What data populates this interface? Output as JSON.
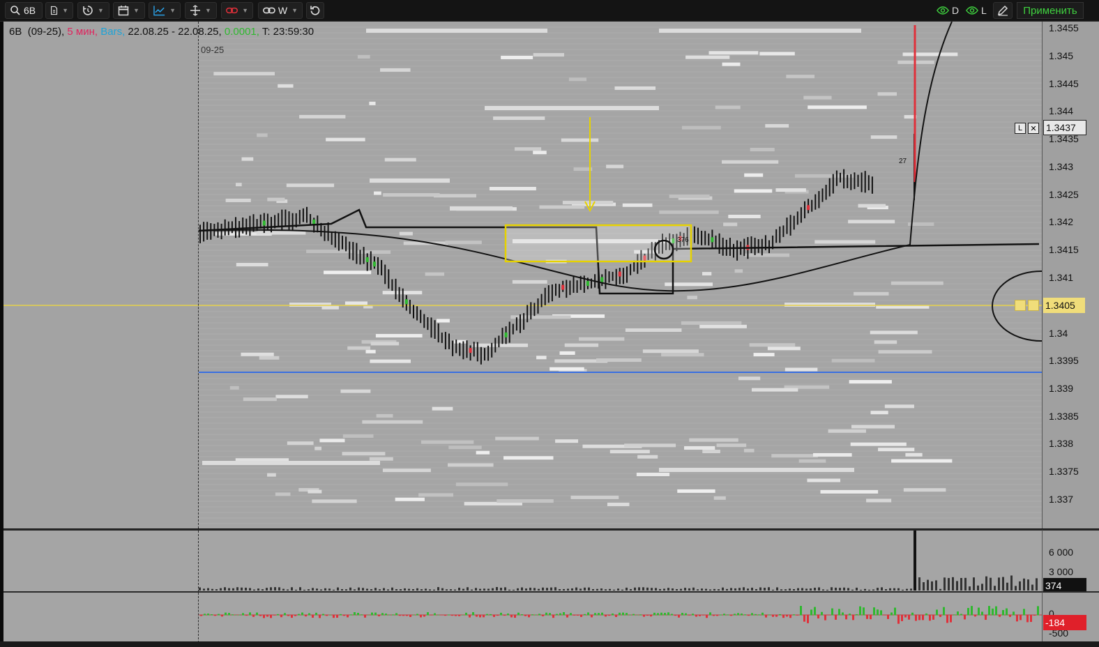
{
  "toolbar": {
    "symbol": "6B",
    "link_label": "W",
    "filter_d": "D",
    "filter_l": "L",
    "apply_label": "Применить"
  },
  "chart": {
    "symbol": "6B",
    "contract": "(09-25),",
    "timeframe": "5 мин,",
    "style": "Bars,",
    "dates": "22.08.25 - 22.08.25,",
    "tick": "0.0001,",
    "time": "T: 23:59:30",
    "contract_label": "09-25",
    "annotations": {
      "marker_a": "376",
      "marker_b": "27"
    },
    "colors": {
      "timeframe": "#e0245e",
      "style": "#1fa3d6",
      "tick": "#2fb82f",
      "yellow_line": "#e6d24a",
      "blue_line": "#3a6fe0"
    }
  },
  "price_axis": {
    "ticks": [
      "1.3455",
      "1.345",
      "1.3445",
      "1.344",
      "1.3435",
      "1.343",
      "1.3425",
      "1.342",
      "1.3415",
      "1.341",
      "1.3405",
      "1.34",
      "1.3395",
      "1.339",
      "1.3385",
      "1.338",
      "1.3375",
      "1.337"
    ],
    "alert_label": "1.3437",
    "current_label": "1.3405",
    "alert_l": "L",
    "alert_x": "✕"
  },
  "volume_axis": {
    "ticks": [
      "6 000",
      "3 000"
    ],
    "current": "374"
  },
  "delta_axis": {
    "ticks": [
      "0",
      "-500"
    ],
    "current": "-184"
  },
  "chart_data": {
    "type": "bar",
    "ylim": [
      1.3366,
      1.3457
    ],
    "ohlc_close_sample": [
      1.3418,
      1.3419,
      1.342,
      1.3421,
      1.3416,
      1.3412,
      1.3404,
      1.3398,
      1.3396,
      1.3402,
      1.3408,
      1.3409,
      1.3411,
      1.3416,
      1.3418,
      1.3415,
      1.3416,
      1.3422,
      1.3428,
      1.3427
    ],
    "volume_peak": 7000,
    "volume_last": 374,
    "delta_last": -184
  }
}
